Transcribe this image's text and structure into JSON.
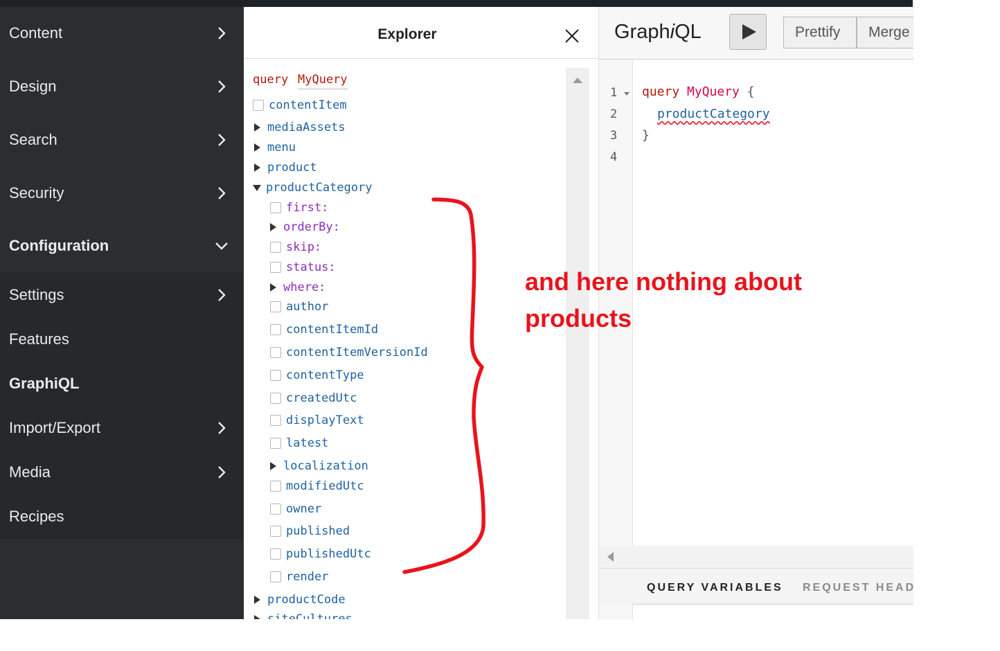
{
  "sidebar": {
    "items": [
      {
        "label": "Content"
      },
      {
        "label": "Design"
      },
      {
        "label": "Search"
      },
      {
        "label": "Security"
      },
      {
        "label": "Configuration"
      },
      {
        "label": "Settings"
      },
      {
        "label": "Features"
      },
      {
        "label": "GraphiQL"
      },
      {
        "label": "Import/Export"
      },
      {
        "label": "Media"
      },
      {
        "label": "Recipes"
      }
    ]
  },
  "explorer": {
    "title": "Explorer",
    "query_keyword": "query",
    "query_name": "MyQuery",
    "root_fields": [
      "contentItem",
      "mediaAssets",
      "menu",
      "product",
      "productCategory"
    ],
    "args": [
      "first:",
      "orderBy:",
      "skip:",
      "status:",
      "where:"
    ],
    "subfields": [
      "author",
      "contentItemId",
      "contentItemVersionId",
      "contentType",
      "createdUtc",
      "displayText",
      "latest",
      "localization",
      "modifiedUtc",
      "owner",
      "published",
      "publishedUtc",
      "render"
    ],
    "after_fields": [
      "productCode",
      "siteCultures"
    ]
  },
  "graphiql": {
    "logo_prefix": "Graph",
    "logo_italic": "i",
    "logo_suffix": "QL",
    "buttons": {
      "prettify": "Prettify",
      "merge": "Merge"
    },
    "line_numbers": [
      "1",
      "2",
      "3",
      "4"
    ],
    "code": {
      "keyword": "query",
      "name": "MyQuery",
      "open": "{",
      "field": "productCategory",
      "close": "}"
    },
    "tabs": {
      "variables": "QUERY VARIABLES",
      "headers": "REQUEST HEAD"
    }
  },
  "annotation": {
    "line1": "and here nothing about",
    "line2": "products"
  },
  "colors": {
    "sidebar_bg": "#2a2e30",
    "annotation_red": "#e8141c",
    "field_blue": "#1f61a0",
    "arg_purple": "#8b2bb9"
  }
}
